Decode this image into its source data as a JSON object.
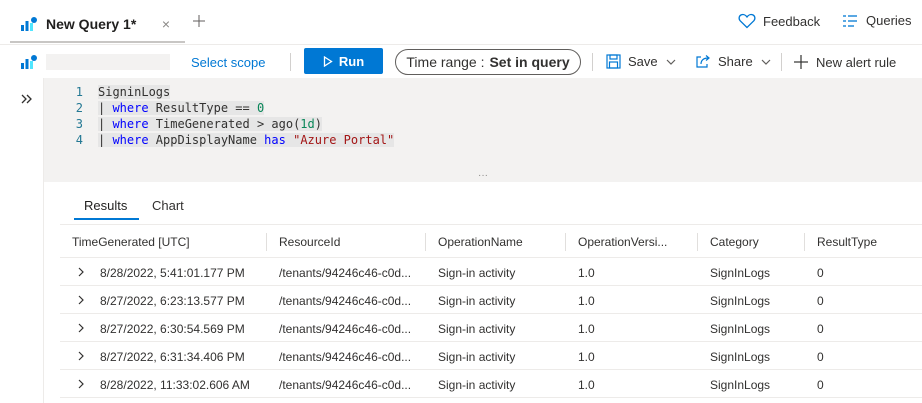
{
  "tab": {
    "title": "New Query 1*",
    "close": "×"
  },
  "header": {
    "feedback": "Feedback",
    "queries": "Queries"
  },
  "toolbar": {
    "select_scope": "Select scope",
    "run": "Run",
    "time_range_label": "Time range :",
    "time_range_value": "Set in query",
    "save": "Save",
    "share": "Share",
    "new_alert_rule": "New alert rule"
  },
  "editor": {
    "lines": [
      {
        "n": "1",
        "tokens": [
          {
            "t": "SigninLogs",
            "c": "k-tbl"
          }
        ]
      },
      {
        "n": "2",
        "tokens": [
          {
            "t": "| ",
            "c": "k-pipe"
          },
          {
            "t": "where",
            "c": "k-op"
          },
          {
            "t": " ResultType == ",
            "c": "k-fld"
          },
          {
            "t": "0",
            "c": "k-num"
          }
        ]
      },
      {
        "n": "3",
        "tokens": [
          {
            "t": "| ",
            "c": "k-pipe"
          },
          {
            "t": "where",
            "c": "k-op"
          },
          {
            "t": " TimeGenerated > ago(",
            "c": "k-fld"
          },
          {
            "t": "1d",
            "c": "k-num"
          },
          {
            "t": ")",
            "c": "k-fld"
          }
        ]
      },
      {
        "n": "4",
        "tokens": [
          {
            "t": "| ",
            "c": "k-pipe"
          },
          {
            "t": "where",
            "c": "k-op"
          },
          {
            "t": " AppDisplayName ",
            "c": "k-fld"
          },
          {
            "t": "has",
            "c": "k-op"
          },
          {
            "t": " ",
            "c": "k-fld"
          },
          {
            "t": "\"Azure Portal\"",
            "c": "k-str"
          }
        ]
      }
    ],
    "splitter": "···"
  },
  "results": {
    "tabs": [
      "Results",
      "Chart"
    ],
    "columns": [
      "TimeGenerated [UTC]",
      "ResourceId",
      "OperationName",
      "OperationVersi...",
      "Category",
      "ResultType"
    ],
    "rows": [
      [
        "8/28/2022, 5:41:01.177 PM",
        "/tenants/94246c46-c0d...",
        "Sign-in activity",
        "1.0",
        "SignInLogs",
        "0"
      ],
      [
        "8/27/2022, 6:23:13.577 PM",
        "/tenants/94246c46-c0d...",
        "Sign-in activity",
        "1.0",
        "SignInLogs",
        "0"
      ],
      [
        "8/27/2022, 6:30:54.569 PM",
        "/tenants/94246c46-c0d...",
        "Sign-in activity",
        "1.0",
        "SignInLogs",
        "0"
      ],
      [
        "8/27/2022, 6:31:34.406 PM",
        "/tenants/94246c46-c0d...",
        "Sign-in activity",
        "1.0",
        "SignInLogs",
        "0"
      ],
      [
        "8/28/2022, 11:33:02.606 AM",
        "/tenants/94246c46-c0d...",
        "Sign-in activity",
        "1.0",
        "SignInLogs",
        "0"
      ]
    ]
  },
  "colors": {
    "accent": "#0078d4",
    "editor_bg": "#f3f2f1"
  }
}
